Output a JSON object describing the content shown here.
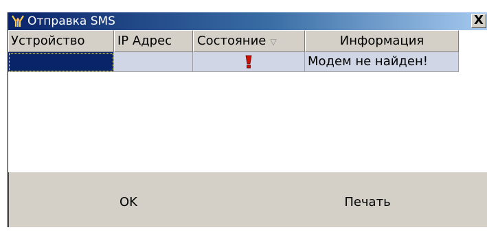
{
  "window": {
    "title": "Отправка SMS",
    "close_label": "X"
  },
  "grid": {
    "columns": [
      {
        "label": "Устройство",
        "sort_icon": ""
      },
      {
        "label": "IP Адрес",
        "sort_icon": ""
      },
      {
        "label": "Состояние",
        "sort_icon": "▽"
      },
      {
        "label": "Информация",
        "sort_icon": ""
      }
    ],
    "rows": [
      {
        "device": "",
        "ip": "",
        "status_icon": "error-icon",
        "info": "Модем не найден!"
      }
    ]
  },
  "buttons": {
    "ok": "OK",
    "print": "Печать"
  },
  "colors": {
    "titlebar_start": "#0a246a",
    "titlebar_end": "#a6caf0",
    "selection": "#0a246a",
    "row_bg": "#d0d6e6",
    "panel_bg": "#d4d0c8",
    "status_icon": "#cc1100"
  }
}
